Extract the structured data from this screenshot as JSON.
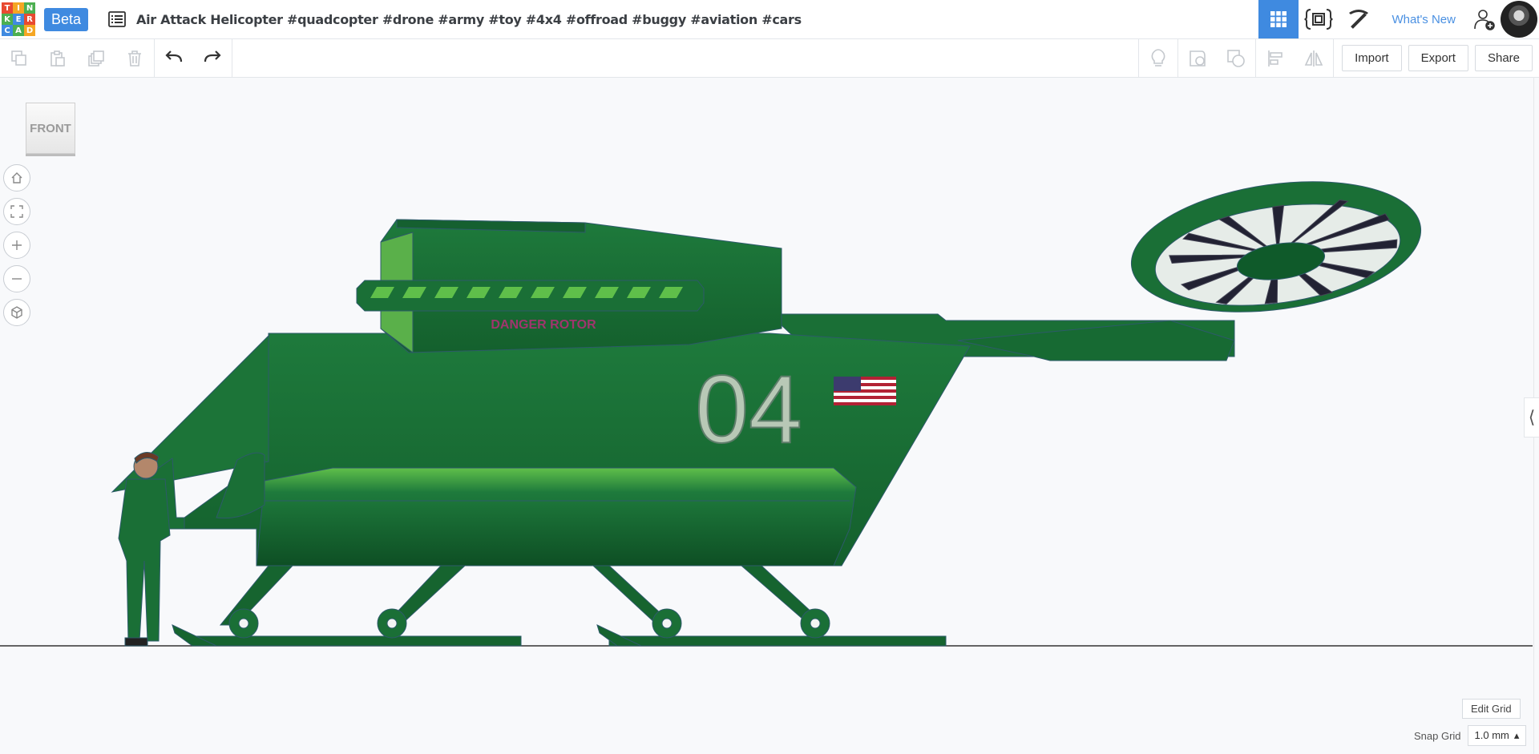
{
  "app": {
    "logo_letters": [
      "T",
      "I",
      "N",
      "K",
      "E",
      "R",
      "C",
      "A",
      "D"
    ],
    "logo_colors": [
      "#e84a31",
      "#f5a623",
      "#4caf50",
      "#4caf50",
      "#3f8ae0",
      "#e84a31",
      "#3f8ae0",
      "#4caf50",
      "#f5a623"
    ],
    "beta_label": "Beta",
    "design_title": "Air Attack Helicopter #quadcopter #drone #army #toy #4x4 #offroad #buggy #aviation #cars",
    "accent_color": "#3f8ae0"
  },
  "header": {
    "icons": [
      "grid-view-icon",
      "code-blocks-icon",
      "pickaxe-icon"
    ],
    "whats_new": "What's New"
  },
  "toolbar": {
    "left_icons": [
      "copy-icon",
      "paste-icon",
      "duplicate-icon",
      "delete-icon"
    ],
    "undo_icon": "undo-icon",
    "redo_icon": "redo-icon",
    "right_icons": [
      "light-bulb-icon",
      "note-icon",
      "group-icon",
      "align-icon",
      "mirror-icon"
    ],
    "import_label": "Import",
    "export_label": "Export",
    "share_label": "Share"
  },
  "viewport": {
    "viewcube_label": "FRONT",
    "nav_icons": [
      "home-view-icon",
      "fit-view-icon",
      "zoom-in-icon",
      "zoom-out-icon",
      "perspective-icon"
    ],
    "model_number": "04",
    "nose_text": "DANGER ROTOR",
    "edit_grid_label": "Edit Grid",
    "snap_grid_label": "Snap Grid",
    "snap_grid_value": "1.0 mm"
  }
}
